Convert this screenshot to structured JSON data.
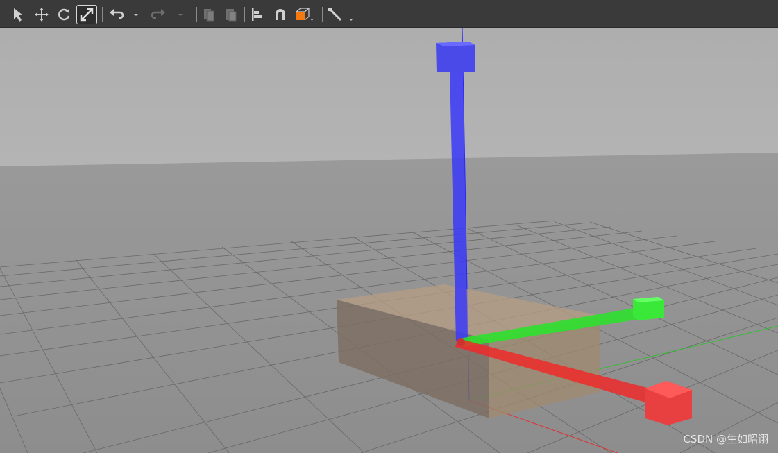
{
  "toolbar": {
    "tools": [
      {
        "name": "select-tool",
        "icon": "arrow-pointer-icon"
      },
      {
        "name": "translate-tool",
        "icon": "move-arrows-icon"
      },
      {
        "name": "rotate-tool",
        "icon": "rotate-icon"
      },
      {
        "name": "scale-tool",
        "icon": "scale-diagonal-icon",
        "active": true
      },
      {
        "name": "undo",
        "icon": "undo-icon"
      },
      {
        "name": "redo",
        "icon": "redo-icon",
        "disabled": true
      },
      {
        "name": "copy",
        "icon": "copy-icon",
        "disabled": true
      },
      {
        "name": "paste",
        "icon": "paste-icon",
        "disabled": true
      },
      {
        "name": "align",
        "icon": "align-icon"
      },
      {
        "name": "snap",
        "icon": "magnet-icon"
      },
      {
        "name": "view-angle",
        "icon": "orange-cube-icon"
      },
      {
        "name": "measure",
        "icon": "ruler-line-icon"
      }
    ]
  },
  "scene": {
    "object": "box",
    "gizmo_mode": "scale",
    "axis_colors": {
      "x": "#ff2020",
      "y": "#20e020",
      "z": "#3a3aff"
    },
    "box_color": "#c8a880",
    "ground_color": "#8f8f8f",
    "sky_color": "#b0b0b0"
  },
  "watermark": "CSDN @生如昭诩"
}
